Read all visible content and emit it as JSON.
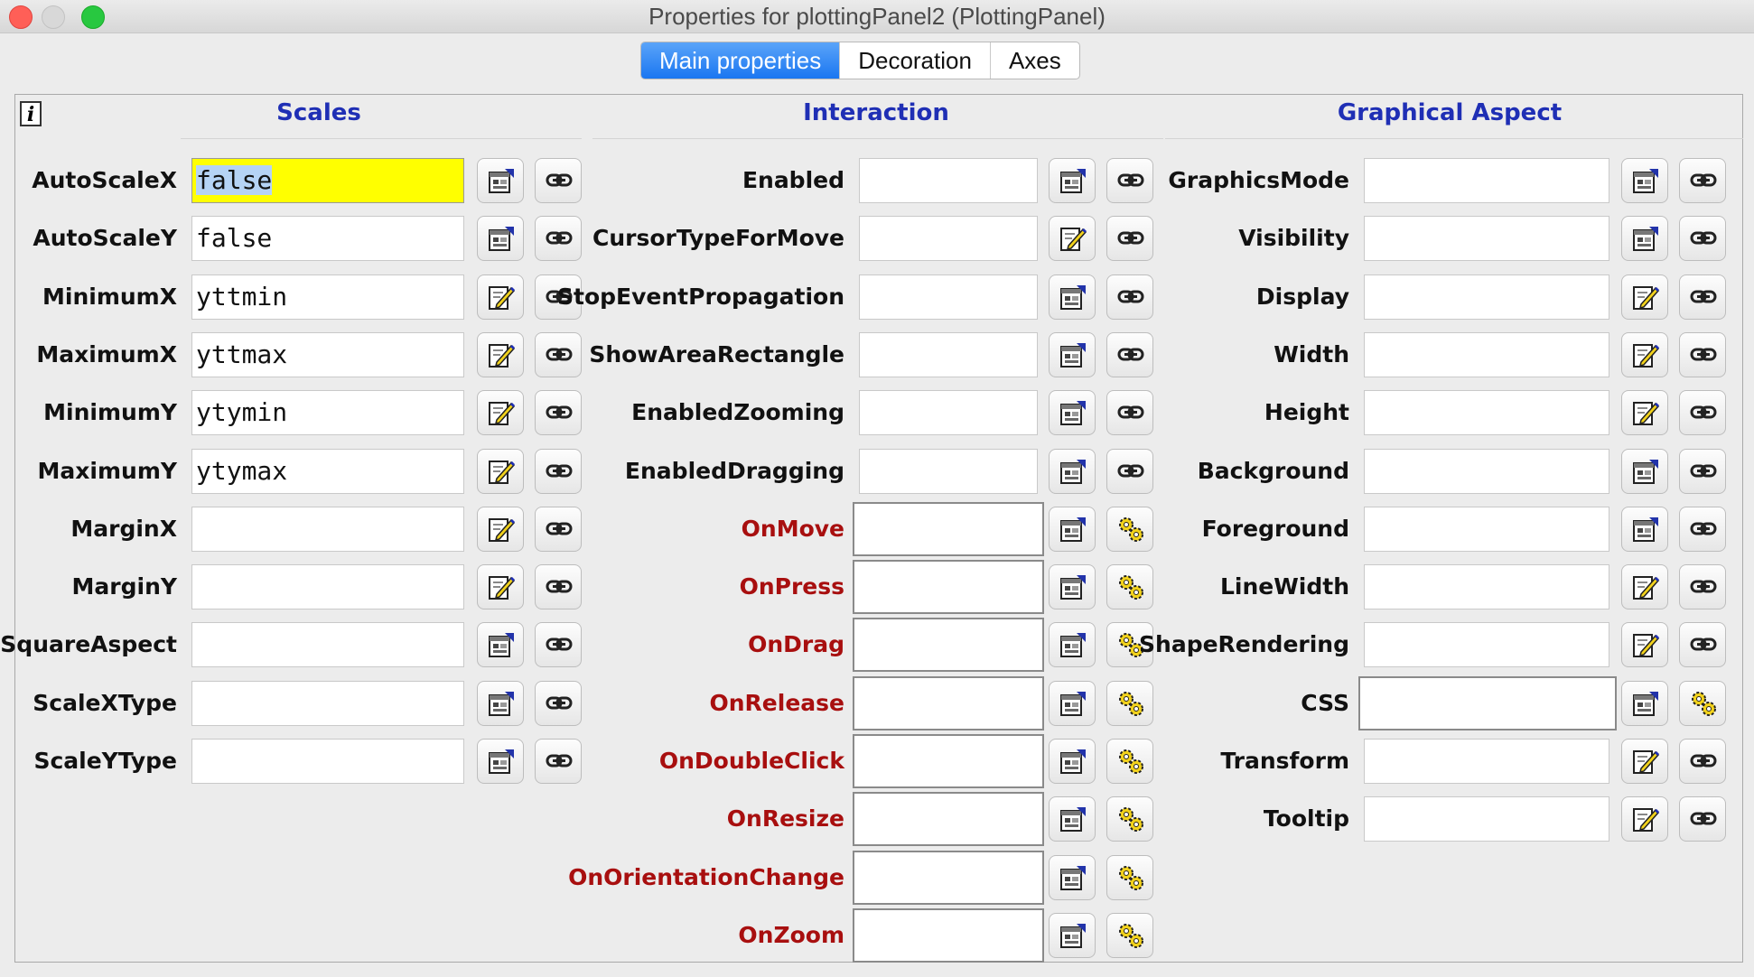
{
  "window": {
    "title": "Properties for plottingPanel2 (PlottingPanel)"
  },
  "tabs": [
    {
      "label": "Main properties",
      "active": true
    },
    {
      "label": "Decoration",
      "active": false
    },
    {
      "label": "Axes",
      "active": false
    }
  ],
  "columns": [
    {
      "title": "Scales",
      "rows": [
        {
          "label": "AutoScaleX",
          "value": "false",
          "highlighted": true,
          "edit_icon": "property-editor-icon",
          "link_icon": "link-icon"
        },
        {
          "label": "AutoScaleY",
          "value": "false",
          "edit_icon": "property-editor-icon",
          "link_icon": "link-icon"
        },
        {
          "label": "MinimumX",
          "value": "yttmin",
          "edit_icon": "pencil-edit-icon",
          "link_icon": "link-icon"
        },
        {
          "label": "MaximumX",
          "value": "yttmax",
          "edit_icon": "pencil-edit-icon",
          "link_icon": "link-icon"
        },
        {
          "label": "MinimumY",
          "value": "ytymin",
          "edit_icon": "pencil-edit-icon",
          "link_icon": "link-icon"
        },
        {
          "label": "MaximumY",
          "value": "ytymax",
          "edit_icon": "pencil-edit-icon",
          "link_icon": "link-icon"
        },
        {
          "label": "MarginX",
          "value": "",
          "edit_icon": "pencil-edit-icon",
          "link_icon": "link-icon"
        },
        {
          "label": "MarginY",
          "value": "",
          "edit_icon": "pencil-edit-icon",
          "link_icon": "link-icon"
        },
        {
          "label": "SquareAspect",
          "value": "",
          "edit_icon": "property-editor-icon",
          "link_icon": "link-icon"
        },
        {
          "label": "ScaleXType",
          "value": "",
          "edit_icon": "property-editor-icon",
          "link_icon": "link-icon"
        },
        {
          "label": "ScaleYType",
          "value": "",
          "edit_icon": "property-editor-icon",
          "link_icon": "link-icon"
        }
      ]
    },
    {
      "title": "Interaction",
      "rows": [
        {
          "label": "Enabled",
          "value": "",
          "edit_icon": "property-editor-icon",
          "link_icon": "link-icon"
        },
        {
          "label": "CursorTypeForMove",
          "value": "",
          "edit_icon": "pencil-edit-icon",
          "link_icon": "link-icon"
        },
        {
          "label": "StopEventPropagation",
          "value": "",
          "edit_icon": "property-editor-icon",
          "link_icon": "link-icon"
        },
        {
          "label": "ShowAreaRectangle",
          "value": "",
          "edit_icon": "property-editor-icon",
          "link_icon": "link-icon"
        },
        {
          "label": "EnabledZooming",
          "value": "",
          "edit_icon": "property-editor-icon",
          "link_icon": "link-icon"
        },
        {
          "label": "EnabledDragging",
          "value": "",
          "edit_icon": "property-editor-icon",
          "link_icon": "link-icon"
        },
        {
          "label": "OnMove",
          "value": "",
          "action": true,
          "edit_icon": "property-editor-icon",
          "link_icon": "gears-icon"
        },
        {
          "label": "OnPress",
          "value": "",
          "action": true,
          "edit_icon": "property-editor-icon",
          "link_icon": "gears-icon"
        },
        {
          "label": "OnDrag",
          "value": "",
          "action": true,
          "edit_icon": "property-editor-icon",
          "link_icon": "gears-icon"
        },
        {
          "label": "OnRelease",
          "value": "",
          "action": true,
          "edit_icon": "property-editor-icon",
          "link_icon": "gears-icon"
        },
        {
          "label": "OnDoubleClick",
          "value": "",
          "action": true,
          "edit_icon": "property-editor-icon",
          "link_icon": "gears-icon"
        },
        {
          "label": "OnResize",
          "value": "",
          "action": true,
          "edit_icon": "property-editor-icon",
          "link_icon": "gears-icon"
        },
        {
          "label": "OnOrientationChange",
          "value": "",
          "action": true,
          "edit_icon": "property-editor-icon",
          "link_icon": "gears-icon"
        },
        {
          "label": "OnZoom",
          "value": "",
          "action": true,
          "edit_icon": "property-editor-icon",
          "link_icon": "gears-icon"
        }
      ]
    },
    {
      "title": "Graphical Aspect",
      "rows": [
        {
          "label": "GraphicsMode",
          "value": "",
          "edit_icon": "property-editor-icon",
          "link_icon": "link-icon"
        },
        {
          "label": "Visibility",
          "value": "",
          "edit_icon": "property-editor-icon",
          "link_icon": "link-icon"
        },
        {
          "label": "Display",
          "value": "",
          "edit_icon": "pencil-edit-icon",
          "link_icon": "link-icon"
        },
        {
          "label": "Width",
          "value": "",
          "edit_icon": "pencil-edit-icon",
          "link_icon": "link-icon"
        },
        {
          "label": "Height",
          "value": "",
          "edit_icon": "pencil-edit-icon",
          "link_icon": "link-icon"
        },
        {
          "label": "Background",
          "value": "",
          "edit_icon": "property-editor-icon",
          "link_icon": "link-icon"
        },
        {
          "label": "Foreground",
          "value": "",
          "edit_icon": "property-editor-icon",
          "link_icon": "link-icon"
        },
        {
          "label": "LineWidth",
          "value": "",
          "edit_icon": "pencil-edit-icon",
          "link_icon": "link-icon"
        },
        {
          "label": "ShapeRendering",
          "value": "",
          "edit_icon": "pencil-edit-icon",
          "link_icon": "link-icon"
        },
        {
          "label": "CSS",
          "value": "",
          "action": true,
          "label_black": true,
          "edit_icon": "property-editor-icon",
          "link_icon": "gears-icon"
        },
        {
          "label": "Transform",
          "value": "",
          "edit_icon": "pencil-edit-icon",
          "link_icon": "link-icon"
        },
        {
          "label": "Tooltip",
          "value": "",
          "edit_icon": "pencil-edit-icon",
          "link_icon": "link-icon"
        }
      ]
    }
  ],
  "colors": {
    "header_text": "#1f2fb5",
    "action_label": "#a80f0f",
    "highlight_field": "#ffff00",
    "tab_active": "#1a76f1"
  }
}
